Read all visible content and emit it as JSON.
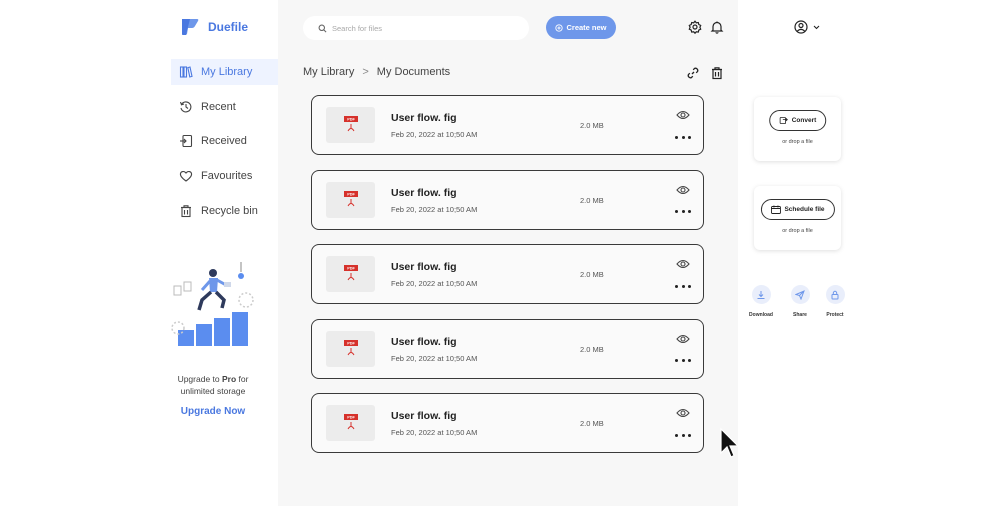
{
  "brand": {
    "name": "Duefile",
    "color": "#4a78e0"
  },
  "sidebar": {
    "items": [
      {
        "label": "My Library",
        "icon": "library-icon",
        "active": true
      },
      {
        "label": "Recent",
        "icon": "history-icon",
        "active": false
      },
      {
        "label": "Received",
        "icon": "received-icon",
        "active": false
      },
      {
        "label": "Favourites",
        "icon": "heart-icon",
        "active": false
      },
      {
        "label": "Recycle bin",
        "icon": "trash-icon",
        "active": false
      }
    ],
    "promo": {
      "line1_prefix": "Upgrade to ",
      "line1_bold": "Pro",
      "line1_suffix": " for",
      "line2": "unlimited storage",
      "link": "Upgrade Now"
    }
  },
  "header": {
    "search_placeholder": "Search for files",
    "create_label": "Create new",
    "accent": "#6e97ea"
  },
  "breadcrumb": {
    "root": "My Library",
    "separator": ">",
    "current": "My Documents"
  },
  "files": [
    {
      "name": "User flow. fig",
      "date": "Feb 20, 2022 at 10;50 AM",
      "size": "2.0 MB",
      "type": "PDF"
    },
    {
      "name": "User flow. fig",
      "date": "Feb 20, 2022 at 10;50 AM",
      "size": "2.0 MB",
      "type": "PDF"
    },
    {
      "name": "User flow. fig",
      "date": "Feb 20, 2022 at 10;50 AM",
      "size": "2.0 MB",
      "type": "PDF"
    },
    {
      "name": "User flow. fig",
      "date": "Feb 20, 2022 at 10;50 AM",
      "size": "2.0 MB",
      "type": "PDF"
    },
    {
      "name": "User flow. fig",
      "date": "Feb 20, 2022 at 10;50 AM",
      "size": "2.0 MB",
      "type": "PDF"
    }
  ],
  "right_panel": {
    "convert": {
      "label": "Convert",
      "drop": "or drop a file"
    },
    "schedule": {
      "label": "Schedule file",
      "drop": "or drop a file"
    },
    "quick_actions": [
      {
        "label": "Download",
        "icon": "download-icon"
      },
      {
        "label": "Share",
        "icon": "send-icon"
      },
      {
        "label": "Protect",
        "icon": "lock-icon"
      }
    ]
  }
}
